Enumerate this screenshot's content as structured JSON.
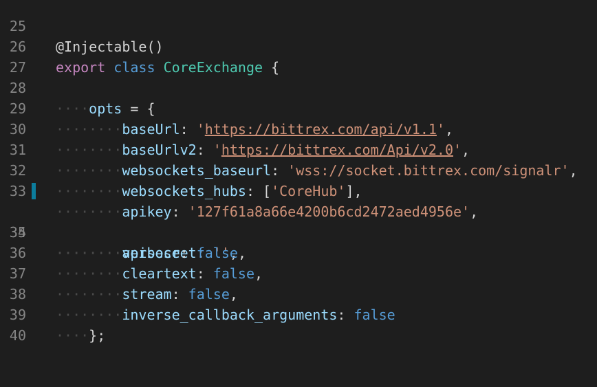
{
  "editor": {
    "partial_top": "@Injectable()",
    "lines": [
      {
        "n": "25"
      },
      {
        "n": "26",
        "export_kw": "export",
        "class_kw": "class",
        "class_name": "CoreExchange",
        "brace": "{"
      },
      {
        "n": "27"
      },
      {
        "n": "28",
        "indent": "····",
        "key": "opts",
        "op": "=",
        "brace": "{"
      },
      {
        "n": "29",
        "indent": "········",
        "key": "baseUrl",
        "q1": "'",
        "value": "https://bittrex.com/api/v1.1",
        "q2": "'",
        "end": ","
      },
      {
        "n": "30",
        "indent": "········",
        "key": "baseUrlv2",
        "q1": "'",
        "value": "https://bittrex.com/Api/v2.0",
        "q2": "'",
        "end": ","
      },
      {
        "n": "31",
        "indent": "········",
        "key": "websockets_baseurl",
        "value": "'wss://socket.bittrex.com/signalr'",
        "end": ","
      },
      {
        "n": "32",
        "indent": "········",
        "key": "websockets_hubs",
        "open": "[",
        "value": "'CoreHub'",
        "close": "]",
        "end": ","
      },
      {
        "n": "33",
        "indent": "········",
        "key": "apikey",
        "value": "'127f61a8a66e4200b6cd2472aed4956e'",
        "end": ","
      },
      {
        "n": "34",
        "indent": "········",
        "key": "apisecret",
        "value": "''",
        "end": ","
      },
      {
        "n": "35",
        "indent": "········",
        "key": "verbose",
        "value": "false",
        "end": ","
      },
      {
        "n": "36",
        "indent": "········",
        "key": "cleartext",
        "value": "false",
        "end": ","
      },
      {
        "n": "37",
        "indent": "········",
        "key": "stream",
        "value": "false",
        "end": ","
      },
      {
        "n": "38",
        "indent": "········",
        "key": "inverse_callback_arguments",
        "value": "false"
      },
      {
        "n": "39",
        "indent": "····",
        "close": "};"
      },
      {
        "n": "40"
      }
    ]
  },
  "colors": {
    "background": "#1e1e1e",
    "line_number": "#858585",
    "keyword": "#c586c0",
    "class_name": "#4ec9b0",
    "property": "#9cdcfe",
    "string": "#ce9178",
    "boolean": "#569cd6",
    "whitespace_dots": "#4a4a4a",
    "modified_gutter": "#0c7d9d"
  }
}
